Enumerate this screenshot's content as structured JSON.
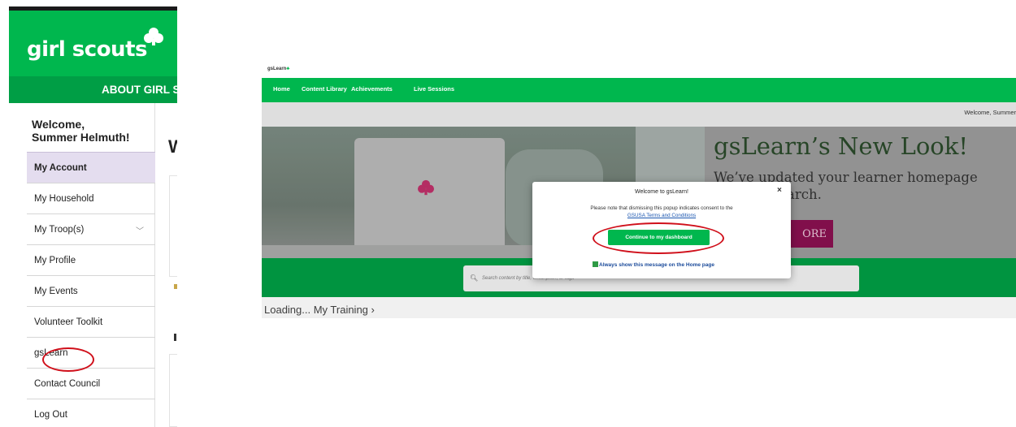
{
  "left_panel": {
    "logo": "girl scouts",
    "about": "ABOUT GIRL S",
    "welcome_line1": "Welcome,",
    "welcome_line2": "Summer Helmuth!",
    "page_letter": "W",
    "menu": [
      {
        "label": "My Account",
        "active": true
      },
      {
        "label": "My Household"
      },
      {
        "label": "My Troop(s)",
        "expandable": true
      },
      {
        "label": "My Profile"
      },
      {
        "label": "My Events"
      },
      {
        "label": "Volunteer Toolkit"
      },
      {
        "label": "gsLearn",
        "highlighted": true
      },
      {
        "label": "Contact Council"
      },
      {
        "label": "Log Out"
      }
    ],
    "colors": {
      "brand_green": "#00b74e",
      "active_bg": "#e4ddef",
      "highlight": "#d0101b"
    }
  },
  "gslearn": {
    "logo": "gsLearn",
    "nav": [
      "Home",
      "Content Library",
      "Achievements",
      "Live Sessions"
    ],
    "welcome": "Welcome, Summer",
    "banner_title": "gsLearn’s New Look!",
    "banner_sub_line1": "We’ve updated your learner homepage",
    "banner_sub_line2": "arch.",
    "banner_button": "ORE",
    "search_placeholder": "Search content by title, description, or tags",
    "loading": "Loading... My Training ›",
    "modal": {
      "title": "Welcome to gsLearn!",
      "close": "×",
      "note": "Please note that dismissing this popup indicates consent to the",
      "link": "GSUSA Terms and Conditions",
      "button": "Continue to my dashboard",
      "checkbox_label": "Always show this message on the Home page",
      "checkbox_checked": true
    }
  }
}
